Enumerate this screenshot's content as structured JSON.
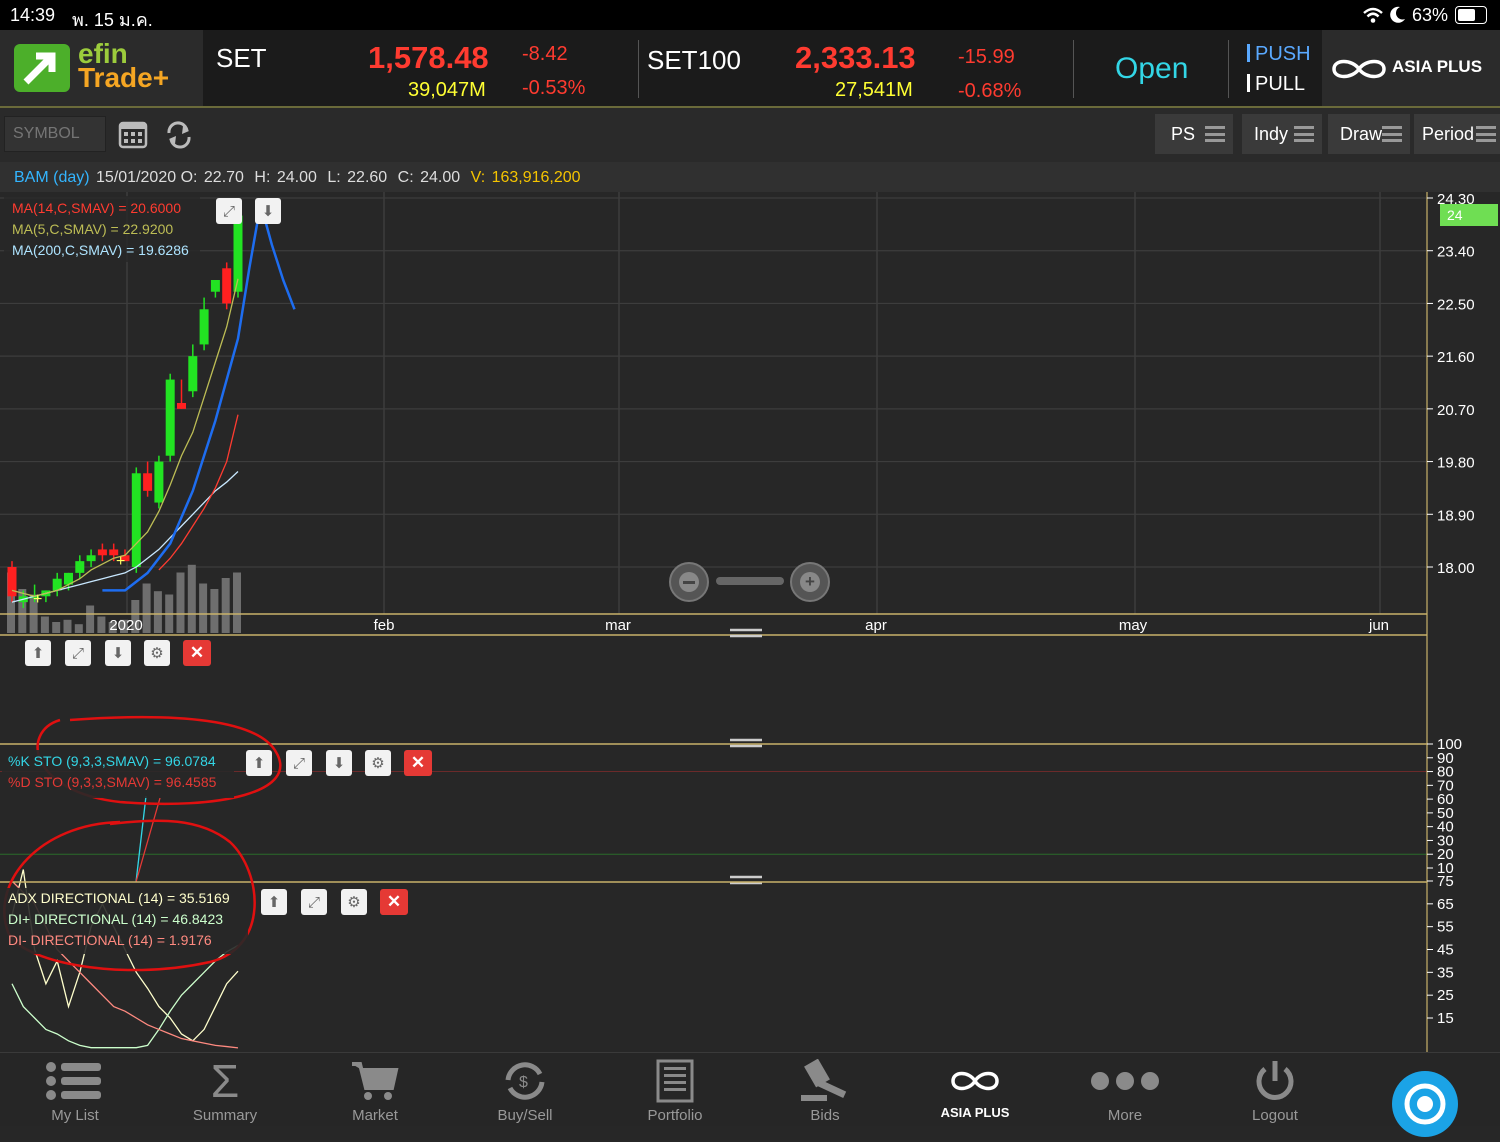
{
  "status_bar": {
    "time": "14:39",
    "date": "พ. 15 ม.ค.",
    "battery": "63%"
  },
  "brand": {
    "logo_line1": "efin",
    "logo_line2": "Trade+",
    "partner": "ASIA PLUS"
  },
  "ticker": [
    {
      "name": "SET",
      "value": "1,578.48",
      "change": "-8.42",
      "volume": "39,047M",
      "pct": "-0.53%"
    },
    {
      "name": "SET100",
      "value": "2,333.13",
      "change": "-15.99",
      "volume": "27,541M",
      "pct": "-0.68%"
    }
  ],
  "market_status": "Open",
  "push_label": "PUSH",
  "pull_label": "PULL",
  "toolbar": {
    "symbol_placeholder": "SYMBOL",
    "ps": "PS",
    "indy": "Indy",
    "draw": "Draw",
    "period": "Period"
  },
  "quote": {
    "symbol": "BAM (day)",
    "date": "15/01/2020",
    "o_label": "O:",
    "o": "22.70",
    "h_label": "H:",
    "h": "24.00",
    "l_label": "L:",
    "l": "22.60",
    "c_label": "C:",
    "c": "24.00",
    "v_label": "V:",
    "v": "163,916,200"
  },
  "legend_ma": [
    {
      "text": "MA(14,C,SMAV) = 20.6000",
      "color": "#ff3b30"
    },
    {
      "text": "MA(5,C,SMAV) = 22.9200",
      "color": "#bdbd55"
    },
    {
      "text": "MA(200,C,SMAV) = 19.6286",
      "color": "#aee4ff"
    }
  ],
  "legend_sto": [
    {
      "text": "%K STO (9,3,3,SMAV) = 96.0784",
      "color": "#33d6e6"
    },
    {
      "text": "%D STO (9,3,3,SMAV) = 96.4585",
      "color": "#e53935"
    }
  ],
  "legend_adx": [
    {
      "text": "ADX DIRECTIONAL (14) = 35.5169",
      "color": "#ffffcc"
    },
    {
      "text": "DI+ DIRECTIONAL (14) = 46.8423",
      "color": "#ccffcc"
    },
    {
      "text": "DI- DIRECTIONAL (14) = 1.9176",
      "color": "#ff8a80"
    }
  ],
  "price_axis": {
    "ticks": [
      "24.30",
      "23.40",
      "22.50",
      "21.60",
      "20.70",
      "19.80",
      "18.90",
      "18.00"
    ],
    "last_price_tag": "24"
  },
  "time_axis": [
    "2020",
    "feb",
    "mar",
    "apr",
    "may",
    "jun"
  ],
  "sto_axis": [
    "100",
    "90",
    "80",
    "70",
    "60",
    "50",
    "40",
    "30",
    "20",
    "10"
  ],
  "adx_axis": [
    "75",
    "65",
    "55",
    "45",
    "35",
    "25",
    "15"
  ],
  "chart_data": {
    "type": "candlestick",
    "title": "BAM (day)",
    "ylim": [
      17.2,
      24.3
    ],
    "candles": [
      {
        "o": 18.0,
        "h": 18.1,
        "l": 17.4,
        "c": 17.5
      },
      {
        "o": 17.4,
        "h": 17.6,
        "l": 17.3,
        "c": 17.5
      },
      {
        "o": 17.5,
        "h": 17.7,
        "l": 17.4,
        "c": 17.5
      },
      {
        "o": 17.5,
        "h": 17.6,
        "l": 17.4,
        "c": 17.6
      },
      {
        "o": 17.6,
        "h": 17.9,
        "l": 17.5,
        "c": 17.8
      },
      {
        "o": 17.7,
        "h": 17.9,
        "l": 17.6,
        "c": 17.9
      },
      {
        "o": 17.9,
        "h": 18.2,
        "l": 17.8,
        "c": 18.1
      },
      {
        "o": 18.1,
        "h": 18.3,
        "l": 18.0,
        "c": 18.2
      },
      {
        "o": 18.3,
        "h": 18.4,
        "l": 18.1,
        "c": 18.2
      },
      {
        "o": 18.3,
        "h": 18.4,
        "l": 18.1,
        "c": 18.2
      },
      {
        "o": 18.2,
        "h": 18.3,
        "l": 18.1,
        "c": 18.1
      },
      {
        "o": 18.0,
        "h": 19.7,
        "l": 17.9,
        "c": 19.6
      },
      {
        "o": 19.6,
        "h": 19.8,
        "l": 19.2,
        "c": 19.3
      },
      {
        "o": 19.1,
        "h": 19.9,
        "l": 19.0,
        "c": 19.8
      },
      {
        "o": 19.9,
        "h": 21.3,
        "l": 19.8,
        "c": 21.2
      },
      {
        "o": 20.8,
        "h": 21.2,
        "l": 20.7,
        "c": 20.7
      },
      {
        "o": 21.0,
        "h": 21.8,
        "l": 20.9,
        "c": 21.6
      },
      {
        "o": 21.8,
        "h": 22.6,
        "l": 21.7,
        "c": 22.4
      },
      {
        "o": 22.7,
        "h": 22.9,
        "l": 22.6,
        "c": 22.9
      },
      {
        "o": 23.1,
        "h": 23.2,
        "l": 22.4,
        "c": 22.5
      },
      {
        "o": 22.7,
        "h": 24.0,
        "l": 22.6,
        "c": 24.0
      }
    ],
    "volume": [
      0.55,
      0.4,
      0.35,
      0.15,
      0.1,
      0.12,
      0.08,
      0.25,
      0.15,
      0.1,
      0.12,
      0.3,
      0.45,
      0.38,
      0.35,
      0.55,
      0.62,
      0.45,
      0.4,
      0.5,
      0.55
    ],
    "ma14": [
      null,
      null,
      null,
      null,
      null,
      null,
      null,
      null,
      null,
      null,
      null,
      null,
      null,
      17.95,
      18.15,
      18.4,
      18.7,
      19.0,
      19.35,
      19.8,
      20.6
    ],
    "ma5": [
      17.6,
      17.55,
      17.5,
      17.55,
      17.6,
      17.7,
      17.8,
      17.95,
      18.05,
      18.15,
      18.2,
      18.4,
      18.6,
      18.95,
      19.4,
      19.9,
      20.3,
      20.9,
      21.5,
      22.1,
      22.92
    ],
    "ma200": [
      17.4,
      17.45,
      17.5,
      17.55,
      17.6,
      17.65,
      17.7,
      17.75,
      17.8,
      17.85,
      17.9,
      18.0,
      18.15,
      18.3,
      18.5,
      18.7,
      18.9,
      19.1,
      19.3,
      19.45,
      19.63
    ],
    "ma_long_blue": [
      [
        8,
        17.6
      ],
      [
        10,
        17.6
      ],
      [
        12,
        17.9
      ],
      [
        14,
        18.4
      ],
      [
        16,
        19.3
      ],
      [
        18,
        20.5
      ],
      [
        20,
        21.9
      ],
      [
        21,
        23.1
      ],
      [
        22,
        24.2
      ],
      [
        23,
        23.5
      ],
      [
        24,
        22.9
      ],
      [
        25,
        22.4
      ]
    ],
    "adx": [
      60,
      80,
      45,
      30,
      40,
      20,
      35,
      55,
      65,
      55,
      45,
      35,
      28,
      20,
      15,
      8,
      5,
      10,
      20,
      30,
      35.5
    ],
    "di_plus": [
      30,
      20,
      15,
      10,
      8,
      5,
      3,
      2,
      2,
      2,
      2,
      2,
      3,
      10,
      18,
      25,
      30,
      35,
      40,
      44,
      46.8
    ],
    "di_minus": [
      75,
      70,
      65,
      55,
      45,
      40,
      35,
      30,
      25,
      20,
      18,
      15,
      12,
      10,
      8,
      6,
      5,
      4,
      3,
      2.5,
      1.9
    ]
  },
  "nav": [
    {
      "label": "My List",
      "icon": "list-icon"
    },
    {
      "label": "Summary",
      "icon": "sigma-icon"
    },
    {
      "label": "Market",
      "icon": "cart-icon"
    },
    {
      "label": "Buy/Sell",
      "icon": "exchange-icon"
    },
    {
      "label": "Portfolio",
      "icon": "document-icon"
    },
    {
      "label": "Bids",
      "icon": "gavel-icon"
    },
    {
      "label": "ASIA PLUS",
      "icon": "infinity-icon"
    },
    {
      "label": "More",
      "icon": "dots-icon"
    },
    {
      "label": "Logout",
      "icon": "power-icon"
    }
  ]
}
